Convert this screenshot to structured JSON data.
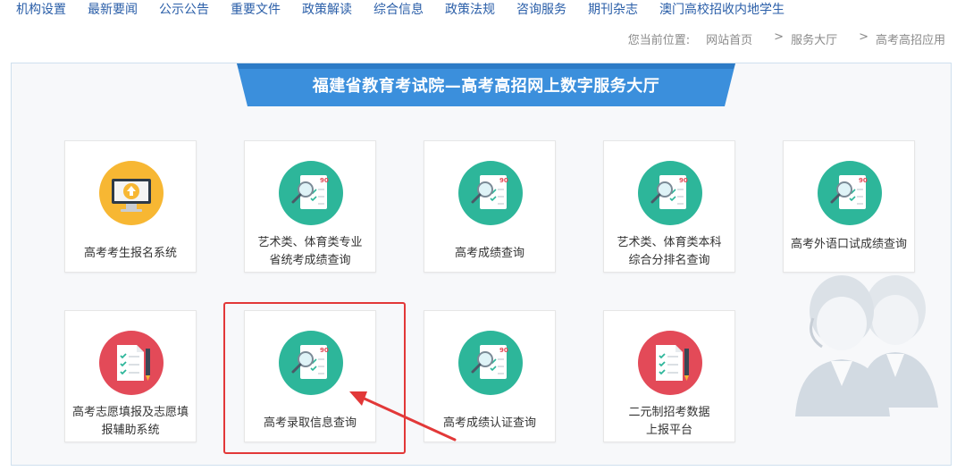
{
  "nav": {
    "items": [
      "机构设置",
      "最新要闻",
      "公示公告",
      "重要文件",
      "政策解读",
      "综合信息",
      "政策法规",
      "咨询服务",
      "期刊杂志",
      "澳门高校招收内地学生"
    ]
  },
  "breadcrumb": {
    "label": "您当前位置:",
    "items": [
      "网站首页",
      "服务大厅",
      "高考高招应用"
    ],
    "sep": ">"
  },
  "banner": {
    "title": "福建省教育考试院—高考高招网上数字服务大厅"
  },
  "cards": [
    {
      "lines": [
        "高考考生报名系统"
      ],
      "icon": "monitor-upload-icon"
    },
    {
      "lines": [
        "艺术类、体育类专业",
        "省统考成绩查询"
      ],
      "icon": "score-sheet-icon"
    },
    {
      "lines": [
        "高考成绩查询"
      ],
      "icon": "score-sheet-icon"
    },
    {
      "lines": [
        "艺术类、体育类本科",
        "综合分排名查询"
      ],
      "icon": "score-sheet-icon"
    },
    {
      "lines": [
        "高考外语口试成绩查询"
      ],
      "icon": "score-sheet-icon"
    },
    {
      "lines": [
        "高考志愿填报及志愿填",
        "报辅助系统"
      ],
      "icon": "checklist-pencil-icon"
    },
    {
      "lines": [
        "高考录取信息查询"
      ],
      "icon": "score-sheet-icon"
    },
    {
      "lines": [
        "高考成绩认证查询"
      ],
      "icon": "score-sheet-icon"
    },
    {
      "lines": [
        "二元制招考数据",
        "上报平台"
      ],
      "icon": "checklist-pencil-icon"
    }
  ],
  "colors": {
    "teal": "#2db69a",
    "orange": "#f7b733",
    "red": "#e34a58",
    "banner_blue": "#3b8fdc",
    "nav_blue": "#2a5ea8",
    "highlight_red": "#e23838"
  },
  "score_mark": "90"
}
